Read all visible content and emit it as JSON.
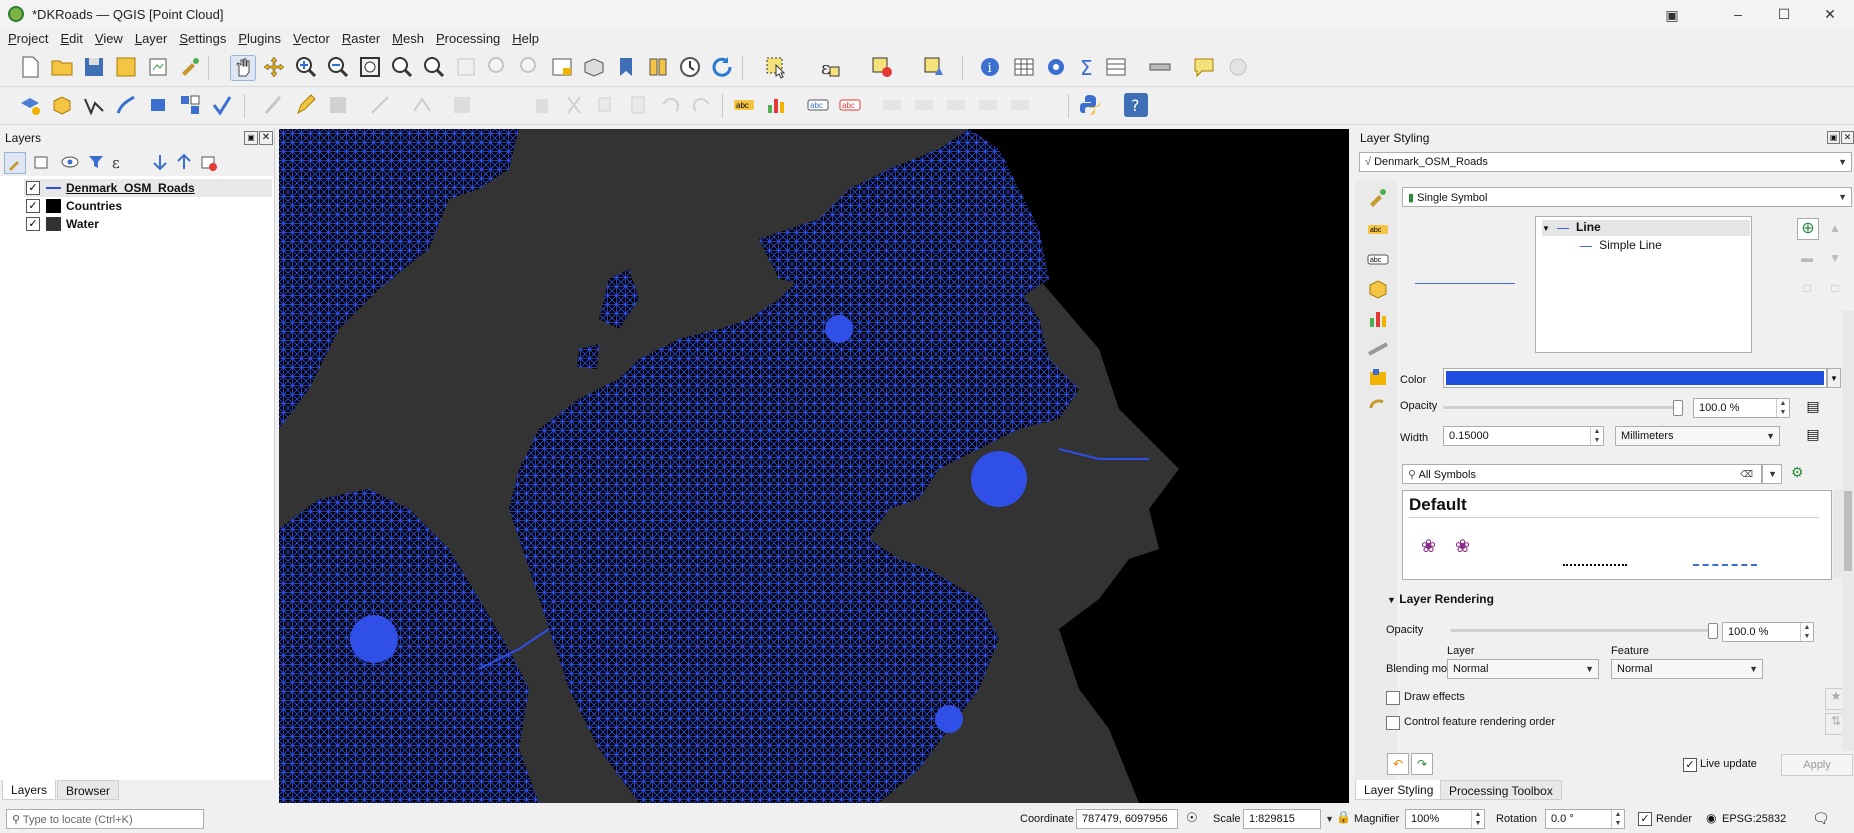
{
  "window": {
    "title": "*DKRoads — QGIS [Point Cloud]",
    "buttons": [
      "minimize",
      "maximize",
      "close"
    ]
  },
  "menu": [
    "Project",
    "Edit",
    "View",
    "Layer",
    "Settings",
    "Plugins",
    "Vector",
    "Raster",
    "Mesh",
    "Processing",
    "Help"
  ],
  "layers_panel": {
    "title": "Layers",
    "layers": [
      {
        "name": "Denmark_OSM_Roads",
        "checked": "✓",
        "swatch": "#3050e0",
        "type": "line"
      },
      {
        "name": "Countries",
        "checked": "✓",
        "swatch": "#000000",
        "type": "fill"
      },
      {
        "name": "Water",
        "checked": "✓",
        "swatch": "#333333",
        "type": "fill"
      }
    ]
  },
  "bottom_tabs": {
    "layers": "Layers",
    "browser": "Browser"
  },
  "locator": {
    "placeholder": "Type to locate (Ctrl+K)"
  },
  "styling": {
    "title": "Layer Styling",
    "layer_select": "Denmark_OSM_Roads",
    "renderer": "Single Symbol",
    "symbol_tree": {
      "root": "Line",
      "child": "Simple Line"
    },
    "color_label": "Color",
    "color_value": "#1f4fe0",
    "opacity_label": "Opacity",
    "opacity_value": "100.0 %",
    "opacity_fraction": 1.0,
    "width_label": "Width",
    "width_value": "0.15000",
    "unit": "Millimeters",
    "search_placeholder": "All Symbols",
    "library_heading": "Default",
    "layer_rendering": "Layer Rendering",
    "lr_opacity_label": "Opacity",
    "lr_opacity_value": "100.0 %",
    "blend_label": "Blending mode",
    "blend_layer_label": "Layer",
    "blend_feature_label": "Feature",
    "blend_layer": "Normal",
    "blend_feature": "Normal",
    "draw_effects": "Draw effects",
    "control_order": "Control feature rendering order",
    "live_update": "Live update",
    "live_checked": "✓",
    "apply": "Apply",
    "tabs": {
      "styling": "Layer Styling",
      "toolbox": "Processing Toolbox"
    }
  },
  "status": {
    "coordinate_label": "Coordinate",
    "coordinate": "787479, 6097956",
    "scale_label": "Scale",
    "scale": "1:829815",
    "magnifier_label": "Magnifier",
    "magnifier": "100%",
    "rotation_label": "Rotation",
    "rotation": "0.0 °",
    "render_label": "Render",
    "render_checked": "✓",
    "crs": "EPSG:25832"
  },
  "colors": {
    "roads": "#2f4fe6",
    "land": "#000000",
    "water": "#333333"
  }
}
